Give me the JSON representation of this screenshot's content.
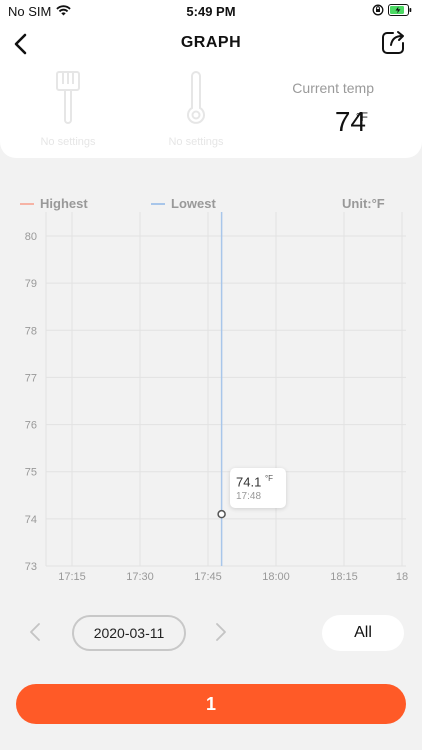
{
  "status_bar": {
    "carrier": "No SIM",
    "time": "5:49 PM"
  },
  "nav": {
    "title": "GRAPH"
  },
  "settings": [
    {
      "label": "No settings",
      "icon": "brush-icon"
    },
    {
      "label": "No settings",
      "icon": "thermometer-icon"
    }
  ],
  "current": {
    "label": "Current temp",
    "value": "74",
    "unit": "°F"
  },
  "chart_data": {
    "type": "line",
    "legend": [
      {
        "label": "Highest",
        "color": "#f6b3a5"
      },
      {
        "label": "Lowest",
        "color": "#a8c6ea"
      }
    ],
    "unit_label": "Unit:°F",
    "y_ticks": [
      "80",
      "79",
      "78",
      "77",
      "76",
      "75",
      "74",
      "73"
    ],
    "ylim": [
      73,
      80
    ],
    "x_ticks": [
      "17:15",
      "17:30",
      "17:45",
      "18:00",
      "18:15",
      "18"
    ],
    "cursor": {
      "time": "17:48",
      "value": 74.1,
      "value_text": "74.1",
      "unit": "°F"
    },
    "series": [
      {
        "name": "Lowest",
        "points": [
          {
            "x": "17:48",
            "y": 74.1
          }
        ]
      }
    ]
  },
  "pager": {
    "date": "2020-03-11",
    "range_button": "All"
  },
  "main_button": {
    "label": "1"
  },
  "colors": {
    "accent": "#ff5a27",
    "highest": "#f6b3a5",
    "lowest": "#a8c6ea"
  }
}
